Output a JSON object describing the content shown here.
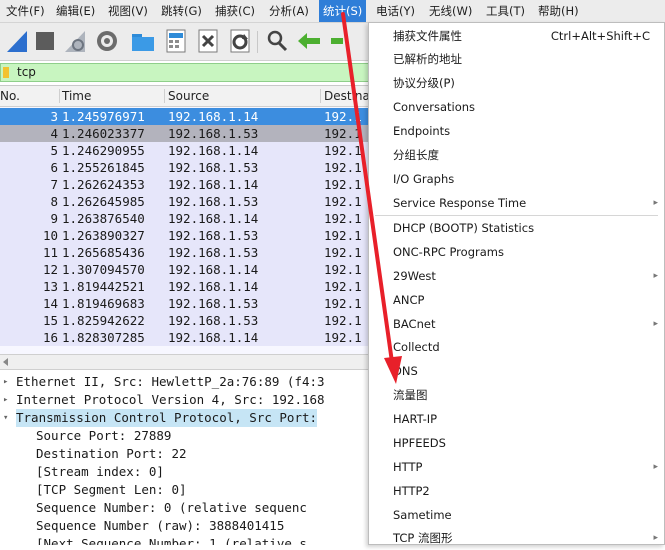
{
  "menubar": [
    "文件(F)",
    "编辑(E)",
    "视图(V)",
    "跳转(G)",
    "捕获(C)",
    "分析(A)",
    "统计(S)",
    "电话(Y)",
    "无线(W)",
    "工具(T)",
    "帮助(H)"
  ],
  "filter": {
    "text": "tcp"
  },
  "packet_list": {
    "columns": {
      "no": "No.",
      "time": "Time",
      "source": "Source",
      "destination": "Destina"
    },
    "rows": [
      {
        "no": "3",
        "time": "1.245976971",
        "source": "192.168.1.14",
        "dest": "192.1"
      },
      {
        "no": "4",
        "time": "1.246023377",
        "source": "192.168.1.53",
        "dest": "192.1"
      },
      {
        "no": "5",
        "time": "1.246290955",
        "source": "192.168.1.14",
        "dest": "192.1"
      },
      {
        "no": "6",
        "time": "1.255261845",
        "source": "192.168.1.53",
        "dest": "192.1"
      },
      {
        "no": "7",
        "time": "1.262624353",
        "source": "192.168.1.14",
        "dest": "192.1"
      },
      {
        "no": "8",
        "time": "1.262645985",
        "source": "192.168.1.53",
        "dest": "192.1"
      },
      {
        "no": "9",
        "time": "1.263876540",
        "source": "192.168.1.14",
        "dest": "192.1"
      },
      {
        "no": "10",
        "time": "1.263890327",
        "source": "192.168.1.53",
        "dest": "192.1"
      },
      {
        "no": "11",
        "time": "1.265685436",
        "source": "192.168.1.53",
        "dest": "192.1"
      },
      {
        "no": "12",
        "time": "1.307094570",
        "source": "192.168.1.14",
        "dest": "192.1"
      },
      {
        "no": "13",
        "time": "1.819442521",
        "source": "192.168.1.14",
        "dest": "192.1"
      },
      {
        "no": "14",
        "time": "1.819469683",
        "source": "192.168.1.53",
        "dest": "192.1"
      },
      {
        "no": "15",
        "time": "1.825942622",
        "source": "192.168.1.53",
        "dest": "192.1"
      },
      {
        "no": "16",
        "time": "1.828307285",
        "source": "192.168.1.14",
        "dest": "192.1"
      }
    ]
  },
  "details": [
    "Ethernet II, Src: HewlettP_2a:76:89 (f4:3",
    "Internet Protocol Version 4, Src: 192.168",
    "Transmission Control Protocol, Src Port:",
    "Source Port: 27889",
    "Destination Port: 22",
    "[Stream index: 0]",
    "[TCP Segment Len: 0]",
    "Sequence Number: 0    (relative sequenc",
    "Sequence Number (raw): 3888401415",
    "[Next Sequence Number: 1    (relative s"
  ],
  "stats_menu": [
    {
      "label": "捕获文件属性",
      "shortcut": "Ctrl+Alt+Shift+C"
    },
    {
      "label": "已解析的地址"
    },
    {
      "label": "协议分级(P)"
    },
    {
      "label": "Conversations"
    },
    {
      "label": "Endpoints"
    },
    {
      "label": "分组长度"
    },
    {
      "label": "I/O Graphs"
    },
    {
      "label": "Service Response Time",
      "submenu": true
    },
    {
      "label": "DHCP (BOOTP) Statistics"
    },
    {
      "label": "ONC-RPC Programs"
    },
    {
      "label": "29West",
      "submenu": true
    },
    {
      "label": "ANCP"
    },
    {
      "label": "BACnet",
      "submenu": true
    },
    {
      "label": "Collectd"
    },
    {
      "label": "DNS"
    },
    {
      "label": "流量图"
    },
    {
      "label": "HART-IP"
    },
    {
      "label": "HPFEEDS"
    },
    {
      "label": "HTTP",
      "submenu": true
    },
    {
      "label": "HTTP2"
    },
    {
      "label": "Sametime"
    },
    {
      "label": "TCP 流图形",
      "submenu": true
    }
  ],
  "icons": [
    "shark-fin-icon",
    "stop-icon",
    "restart-icon",
    "options-gear-icon",
    "open-folder-icon",
    "save-file-icon",
    "close-file-icon",
    "reload-icon",
    "find-icon",
    "back-arrow-icon",
    "forward-arrow-icon"
  ],
  "colors": {
    "menu_highlight": "#2f7ed8",
    "selected_row": "#3c8ddf",
    "row_bg": "#e6e6fa",
    "filter_ok": "#c8f5c0",
    "annotation_arrow": "#e8202a"
  }
}
